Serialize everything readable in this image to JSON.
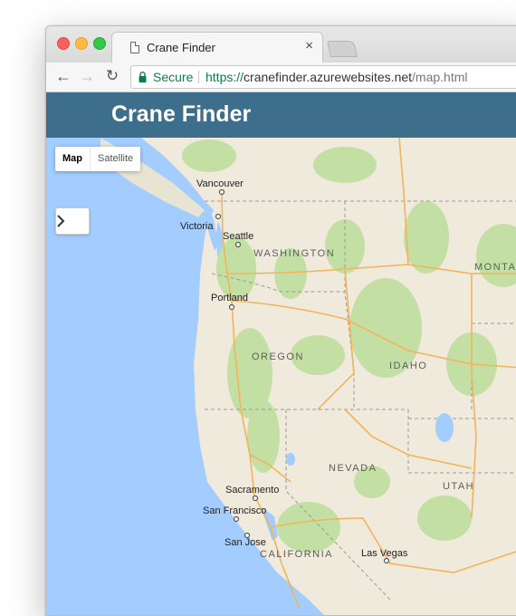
{
  "browser": {
    "tab_title": "Crane Finder",
    "tab_close": "×",
    "nav_back": "←",
    "nav_forward": "→",
    "nav_reload": "↻",
    "secure_label": "Secure",
    "url_scheme": "https://",
    "url_host": "cranefinder.azurewebsites.net",
    "url_path": "/map.html"
  },
  "app": {
    "title": "Crane Finder"
  },
  "map": {
    "map_type_options": [
      "Map",
      "Satellite"
    ],
    "selected_map_type": "Map",
    "expand_button": "›",
    "cities": [
      "Vancouver",
      "Victoria",
      "Seattle",
      "Portland",
      "Sacramento",
      "San Francisco",
      "San Jose",
      "Las Vegas"
    ],
    "regions": [
      "WASHINGTON",
      "OREGON",
      "IDAHO",
      "NEVADA",
      "UTAH",
      "CALIFORNIA",
      "MONTA"
    ]
  },
  "colors": {
    "header": "#3d6e8b",
    "water": "#a3ccff",
    "land": "#efeadb",
    "park": "#c4dfa4",
    "road": "#f2b45a",
    "secure": "#0b8043"
  }
}
